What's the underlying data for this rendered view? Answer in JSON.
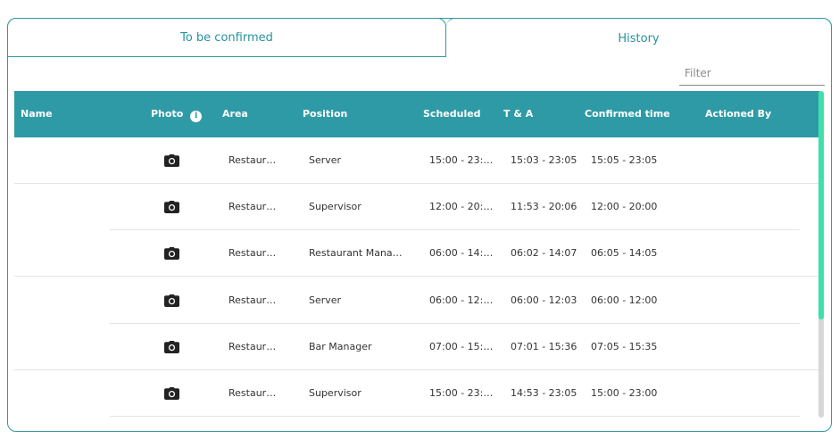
{
  "tabs": [
    {
      "label": "To be confirmed",
      "active": false
    },
    {
      "label": "History",
      "active": true
    }
  ],
  "filter": {
    "placeholder": "Filter",
    "value": ""
  },
  "table": {
    "columns": [
      "Name",
      "Photo",
      "Area",
      "Position",
      "Scheduled",
      "T & A",
      "Confirmed time",
      "Actioned By"
    ],
    "rows": [
      {
        "name": "",
        "photo": "camera-icon",
        "area": "Restaur…",
        "position": "Server",
        "scheduled": "15:00 - 23:…",
        "ta": "15:03 - 23:05",
        "confirmed": "15:05 - 23:05",
        "actioned_by": ""
      },
      {
        "name": "",
        "photo": "camera-icon",
        "area": "Restaur…",
        "position": "Supervisor",
        "scheduled": "12:00 - 20:…",
        "ta": "11:53 - 20:06",
        "confirmed": "12:00 - 20:00",
        "actioned_by": ""
      },
      {
        "name": "",
        "photo": "camera-icon",
        "area": "Restaur…",
        "position": "Restaurant Mana…",
        "scheduled": "06:00 - 14:…",
        "ta": "06:02 - 14:07",
        "confirmed": "06:05 - 14:05",
        "actioned_by": ""
      },
      {
        "name": "",
        "photo": "camera-icon",
        "area": "Restaur…",
        "position": "Server",
        "scheduled": "06:00 - 12:…",
        "ta": "06:00 - 12:03",
        "confirmed": "06:00 - 12:00",
        "actioned_by": ""
      },
      {
        "name": "",
        "photo": "camera-icon",
        "area": "Restaur…",
        "position": "Bar Manager",
        "scheduled": "07:00 - 15:…",
        "ta": "07:01 - 15:36",
        "confirmed": "07:05 - 15:35",
        "actioned_by": ""
      },
      {
        "name": "",
        "photo": "camera-icon",
        "area": "Restaur…",
        "position": "Supervisor",
        "scheduled": "15:00 - 23:…",
        "ta": "14:53 - 23:05",
        "confirmed": "15:00 - 23:00",
        "actioned_by": ""
      }
    ]
  },
  "colors": {
    "accent": "#2e9aa6",
    "tab_text": "#2792a0",
    "scroll_thumb": "#3fe0a8"
  }
}
